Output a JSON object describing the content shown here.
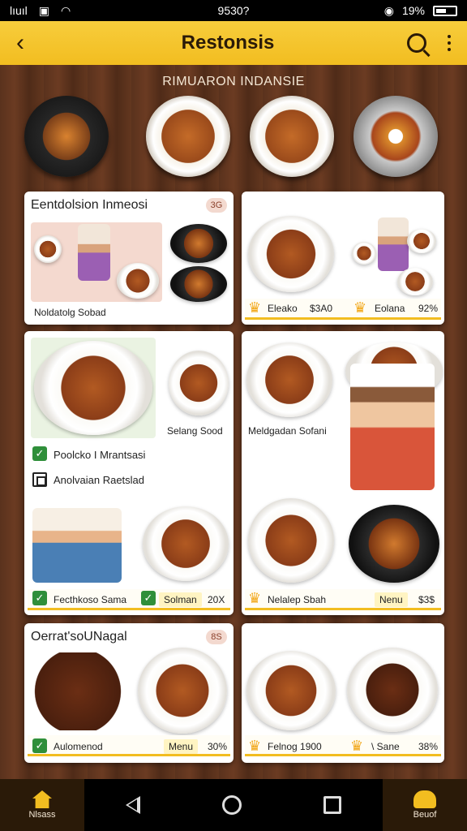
{
  "status_bar": {
    "carrier": "lıuıl",
    "time": "9530?",
    "battery": "19%"
  },
  "app_bar": {
    "title": "Restonsis"
  },
  "section_header": "RIMUARON INDANSIE",
  "cards": {
    "card1": {
      "title": "Eentdolsion Inmeosi",
      "chip": "3G",
      "caption": "Noldatolg Sobad"
    },
    "card2": {
      "label_left": "Eleako",
      "price_left": "$3A0",
      "label_right": "Eolana",
      "price_right": "92%"
    },
    "card3": {
      "caption_top": "Selang Sood",
      "option1": "Poolcko I Mrantsasi",
      "option2": "Anolvaian Raetslad",
      "footer_left": "Fecthkoso Sama",
      "footer_right": "Solman",
      "footer_percent": "20X"
    },
    "card4": {
      "caption": "Meldgadan Sofani",
      "footer_left": "Nelalep Sbah",
      "footer_menu": "Nenu",
      "footer_price": "$3$"
    },
    "card5": {
      "title": "Oerrat'soUNagal",
      "chip": "8S",
      "footer_left": "Aulomenod",
      "footer_menu": "Menu",
      "footer_percent": "30%"
    },
    "card6": {
      "footer_left": "Felnog 1900",
      "footer_right": "\\ Sane",
      "footer_percent": "38%"
    }
  },
  "nav_bar": {
    "left_label": "Nlsass",
    "right_label": "Beuof"
  },
  "colors": {
    "accent": "#f2bd20",
    "wood": "#5a321d",
    "check_green": "#2f8f3a"
  }
}
